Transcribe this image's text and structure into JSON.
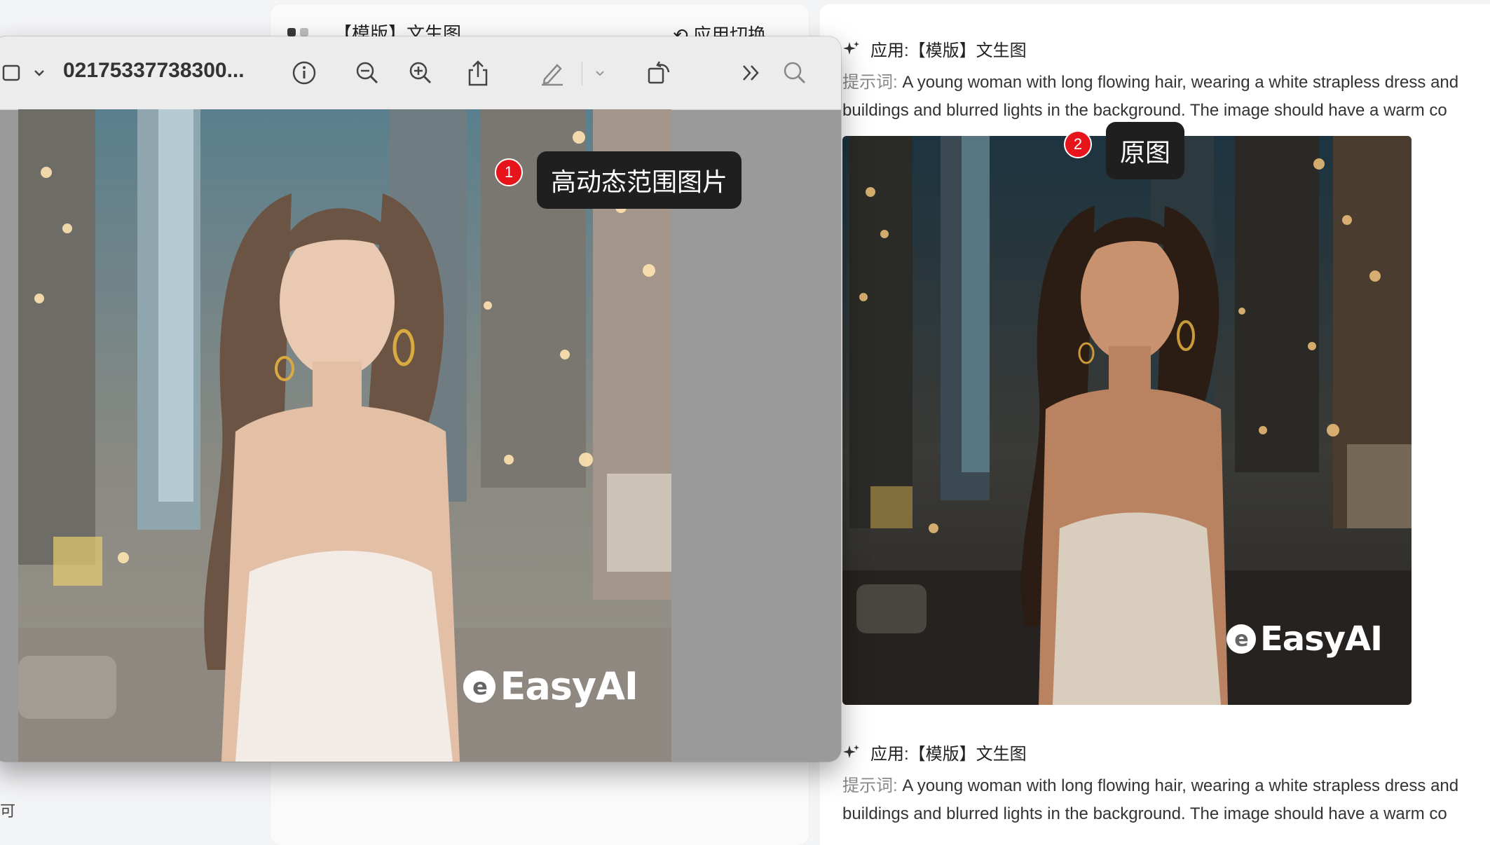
{
  "mid_card": {
    "title": "【模版】文生图",
    "switch_label": "应用切换",
    "dot_colors": [
      "#3a3a3a",
      "#bdbdbd"
    ]
  },
  "viewer": {
    "filename": "02175337738300...",
    "image_watermark": "EasyAI",
    "icons": [
      "sidebar-icon",
      "chevron-down-icon",
      "info-icon",
      "zoom-out-icon",
      "zoom-in-icon",
      "share-icon",
      "markup-pen-icon",
      "chevron-down-icon",
      "rotate-icon",
      "more-chevrons-icon",
      "search-icon"
    ]
  },
  "annotations": [
    {
      "number": "1",
      "label": "高动态范围图片"
    },
    {
      "number": "2",
      "label": "原图"
    }
  ],
  "right_panel": {
    "entries": [
      {
        "app_label": "应用:【模版】文生图",
        "prompt_label": "提示词:",
        "prompt_line1": " A young woman with long flowing hair, wearing a white strapless dress and",
        "prompt_line2": "buildings and blurred lights in the background. The image should have a warm co"
      },
      {
        "app_label": "应用:【模版】文生图",
        "prompt_label": "提示词:",
        "prompt_line1": " A young woman with long flowing hair, wearing a white strapless dress and",
        "prompt_line2": "buildings and blurred lights in the background. The image should have a warm co"
      }
    ],
    "image_watermark": "EasyAI"
  },
  "left_edge_text": "可",
  "colors": {
    "marker_red": "#e8141b",
    "tooltip_bg": "#1f1f1f",
    "viewer_bg": "#9a9a9a"
  }
}
